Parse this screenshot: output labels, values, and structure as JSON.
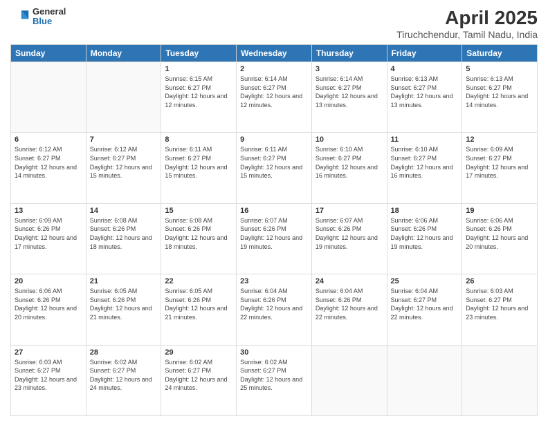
{
  "header": {
    "logo_line1": "General",
    "logo_line2": "Blue",
    "title": "April 2025",
    "subtitle": "Tiruchchendur, Tamil Nadu, India"
  },
  "weekdays": [
    "Sunday",
    "Monday",
    "Tuesday",
    "Wednesday",
    "Thursday",
    "Friday",
    "Saturday"
  ],
  "weeks": [
    [
      {
        "day": "",
        "info": ""
      },
      {
        "day": "",
        "info": ""
      },
      {
        "day": "1",
        "info": "Sunrise: 6:15 AM\nSunset: 6:27 PM\nDaylight: 12 hours and 12 minutes."
      },
      {
        "day": "2",
        "info": "Sunrise: 6:14 AM\nSunset: 6:27 PM\nDaylight: 12 hours and 12 minutes."
      },
      {
        "day": "3",
        "info": "Sunrise: 6:14 AM\nSunset: 6:27 PM\nDaylight: 12 hours and 13 minutes."
      },
      {
        "day": "4",
        "info": "Sunrise: 6:13 AM\nSunset: 6:27 PM\nDaylight: 12 hours and 13 minutes."
      },
      {
        "day": "5",
        "info": "Sunrise: 6:13 AM\nSunset: 6:27 PM\nDaylight: 12 hours and 14 minutes."
      }
    ],
    [
      {
        "day": "6",
        "info": "Sunrise: 6:12 AM\nSunset: 6:27 PM\nDaylight: 12 hours and 14 minutes."
      },
      {
        "day": "7",
        "info": "Sunrise: 6:12 AM\nSunset: 6:27 PM\nDaylight: 12 hours and 15 minutes."
      },
      {
        "day": "8",
        "info": "Sunrise: 6:11 AM\nSunset: 6:27 PM\nDaylight: 12 hours and 15 minutes."
      },
      {
        "day": "9",
        "info": "Sunrise: 6:11 AM\nSunset: 6:27 PM\nDaylight: 12 hours and 15 minutes."
      },
      {
        "day": "10",
        "info": "Sunrise: 6:10 AM\nSunset: 6:27 PM\nDaylight: 12 hours and 16 minutes."
      },
      {
        "day": "11",
        "info": "Sunrise: 6:10 AM\nSunset: 6:27 PM\nDaylight: 12 hours and 16 minutes."
      },
      {
        "day": "12",
        "info": "Sunrise: 6:09 AM\nSunset: 6:27 PM\nDaylight: 12 hours and 17 minutes."
      }
    ],
    [
      {
        "day": "13",
        "info": "Sunrise: 6:09 AM\nSunset: 6:26 PM\nDaylight: 12 hours and 17 minutes."
      },
      {
        "day": "14",
        "info": "Sunrise: 6:08 AM\nSunset: 6:26 PM\nDaylight: 12 hours and 18 minutes."
      },
      {
        "day": "15",
        "info": "Sunrise: 6:08 AM\nSunset: 6:26 PM\nDaylight: 12 hours and 18 minutes."
      },
      {
        "day": "16",
        "info": "Sunrise: 6:07 AM\nSunset: 6:26 PM\nDaylight: 12 hours and 19 minutes."
      },
      {
        "day": "17",
        "info": "Sunrise: 6:07 AM\nSunset: 6:26 PM\nDaylight: 12 hours and 19 minutes."
      },
      {
        "day": "18",
        "info": "Sunrise: 6:06 AM\nSunset: 6:26 PM\nDaylight: 12 hours and 19 minutes."
      },
      {
        "day": "19",
        "info": "Sunrise: 6:06 AM\nSunset: 6:26 PM\nDaylight: 12 hours and 20 minutes."
      }
    ],
    [
      {
        "day": "20",
        "info": "Sunrise: 6:06 AM\nSunset: 6:26 PM\nDaylight: 12 hours and 20 minutes."
      },
      {
        "day": "21",
        "info": "Sunrise: 6:05 AM\nSunset: 6:26 PM\nDaylight: 12 hours and 21 minutes."
      },
      {
        "day": "22",
        "info": "Sunrise: 6:05 AM\nSunset: 6:26 PM\nDaylight: 12 hours and 21 minutes."
      },
      {
        "day": "23",
        "info": "Sunrise: 6:04 AM\nSunset: 6:26 PM\nDaylight: 12 hours and 22 minutes."
      },
      {
        "day": "24",
        "info": "Sunrise: 6:04 AM\nSunset: 6:26 PM\nDaylight: 12 hours and 22 minutes."
      },
      {
        "day": "25",
        "info": "Sunrise: 6:04 AM\nSunset: 6:27 PM\nDaylight: 12 hours and 22 minutes."
      },
      {
        "day": "26",
        "info": "Sunrise: 6:03 AM\nSunset: 6:27 PM\nDaylight: 12 hours and 23 minutes."
      }
    ],
    [
      {
        "day": "27",
        "info": "Sunrise: 6:03 AM\nSunset: 6:27 PM\nDaylight: 12 hours and 23 minutes."
      },
      {
        "day": "28",
        "info": "Sunrise: 6:02 AM\nSunset: 6:27 PM\nDaylight: 12 hours and 24 minutes."
      },
      {
        "day": "29",
        "info": "Sunrise: 6:02 AM\nSunset: 6:27 PM\nDaylight: 12 hours and 24 minutes."
      },
      {
        "day": "30",
        "info": "Sunrise: 6:02 AM\nSunset: 6:27 PM\nDaylight: 12 hours and 25 minutes."
      },
      {
        "day": "",
        "info": ""
      },
      {
        "day": "",
        "info": ""
      },
      {
        "day": "",
        "info": ""
      }
    ]
  ]
}
